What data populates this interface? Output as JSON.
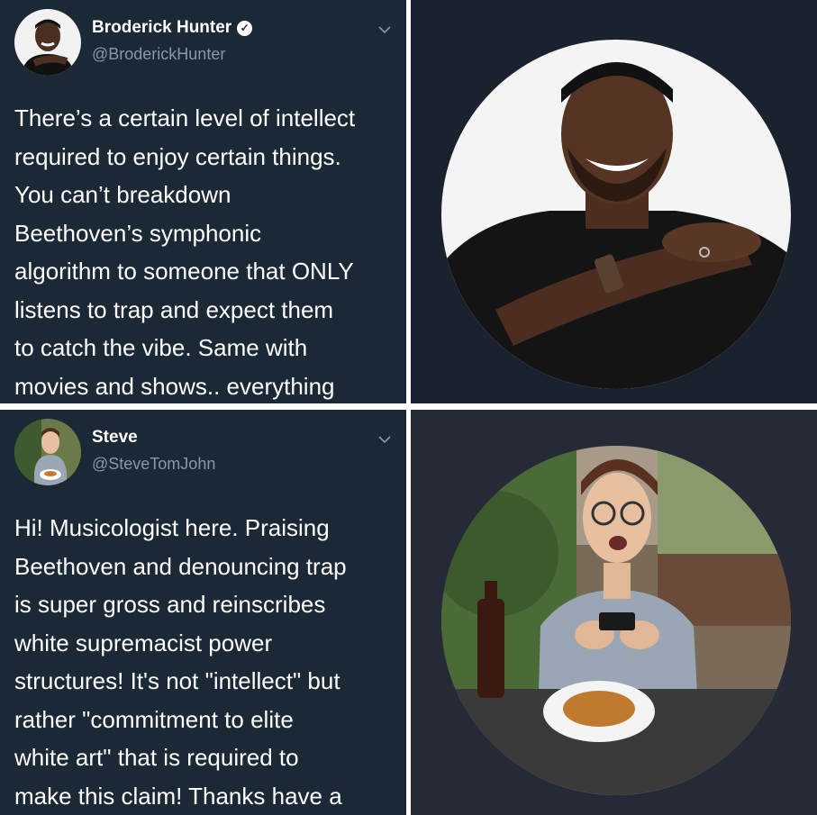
{
  "tweet1": {
    "name": "Broderick Hunter",
    "handle": "@BroderickHunter",
    "verified": true,
    "lines": [
      "There’s a certain level of intellect",
      "required to enjoy certain things.",
      "You can’t breakdown",
      "Beethoven’s symphonic",
      "algorithm to someone that ONLY",
      "listens to trap and expect them",
      "to catch the vibe. Same with",
      "movies and shows.. everything"
    ]
  },
  "tweet2": {
    "name": "Steve",
    "handle": "@SteveTomJohn",
    "lines": [
      "Hi! Musicologist here. Praising",
      "Beethoven and denouncing trap",
      "is super gross and reinscribes",
      "white supremacist power",
      "structures! It's not \"intellect\" but",
      "rather \"commitment to elite",
      "white art\" that is required to",
      "make this claim! Thanks have a"
    ]
  },
  "icons": {
    "verified": "verified-check-icon",
    "menu": "chevron-down-icon"
  },
  "colors": {
    "tweet_bg": "#1b2836",
    "text": "#ffffff",
    "handle": "#8899a6"
  }
}
